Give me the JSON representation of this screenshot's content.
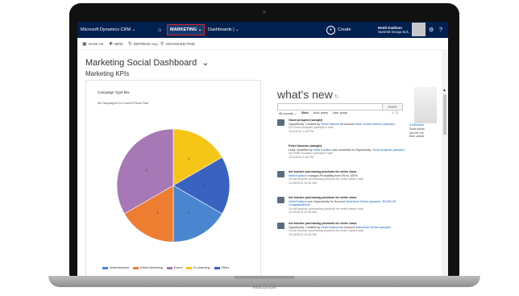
{
  "device": {
    "brand": "MacBook"
  },
  "nav": {
    "app_title": "Microsoft Dynamics CRM",
    "area": "MARKETING",
    "dashboards": "Dashboards",
    "create": "Create",
    "user_name": "Heidi Kadison",
    "user_org": "Summit Group Sol...",
    "home_icon": "home-icon",
    "gear_icon": "gear-icon",
    "help_icon": "help-icon",
    "bg_color": "#002050",
    "area_border_color": "#d9262b"
  },
  "command_bar": {
    "save_as": "SAVE AS",
    "new": "NEW",
    "refresh_all": "REFRESH ALL",
    "advanced_find": "ADVANCED FIND"
  },
  "dashboard": {
    "title": "Marketing Social Dashboard",
    "section": "Marketing KPIs"
  },
  "chart_data": {
    "type": "pie",
    "title": "Campaign Type Mix",
    "subtitle": "All Campaigns for Current Fiscal Year",
    "categories": [
      "Advertisement",
      "Direct Marketing",
      "Event",
      "Co-branding",
      "Other"
    ],
    "values": [
      1,
      1,
      2,
      1,
      1
    ],
    "colors": [
      "#4a86d0",
      "#ed7d31",
      "#a678b6",
      "#f5c518",
      "#3a62c0"
    ]
  },
  "whats_new": {
    "title": "what's new",
    "post_button": "POST",
    "filters": {
      "all_records": "All records",
      "both": "Both",
      "auto_posts": "Auto posts",
      "user_posts": "User posts"
    },
    "posts": [
      {
        "title": "Good prospect (sample)",
        "line1": "Opportunity: Created by",
        "user": "Heidi Kadison",
        "line2": "for Account",
        "link": "Blue Yonder Airlines (sample).",
        "meta1": "On Good prospect (sample)'s wall",
        "meta2": "12/1/2014 3:18 PM"
      },
      {
        "title": "Peter Houston (sample)",
        "line1": "Lead: Qualified by",
        "user": "Heidi Kadison",
        "line2": "and converted to Opportunity:",
        "link": "Good prospect (sample).",
        "meta1": "On Peter Houston (sample)'s wall",
        "meta2": "12/1/2014 3:18 PM"
      },
      {
        "title": "Art teacher purchasing products for entire class",
        "line1": "",
        "user": "Heidi Kadison",
        "line2": "changed Probability from 0% to 100%.",
        "link": "",
        "meta1": "On Art teacher purchasing products for entire class's wall",
        "meta2": "11/18/2014 10:44 AM"
      },
      {
        "title": "Art teacher purchasing products for entire class",
        "line1": "",
        "user": "Heidi Kadison",
        "line2": "won Opportunity for Account",
        "link": "Adventure Works (sample). $3,000.00. Congratulations!",
        "meta1": "On Art teacher purchasing products for entire class's wall",
        "meta2": "11/18/2014 10:44 AM"
      },
      {
        "title": "Art teacher purchasing products for entire class",
        "line1": "Opportunity: Created by",
        "user": "Heidi Kadison",
        "line2": "for Account",
        "link": "Adventure Works (sample).",
        "meta1": "On Art teacher purchasing products for entire class's wall",
        "meta2": "11/18/2014 10:44 AM"
      }
    ]
  },
  "side_panel": {
    "followers": "0 followers",
    "line1": "Start follow",
    "line2": "and let me",
    "line3": "their activit"
  }
}
